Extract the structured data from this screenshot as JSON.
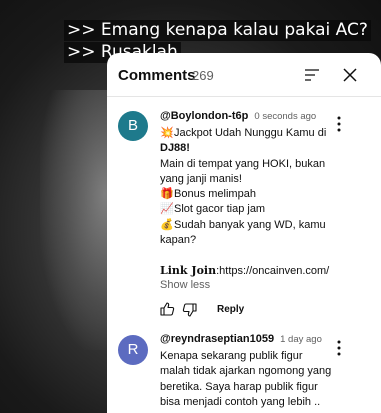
{
  "video": {
    "captions": [
      ">> Emang kenapa kalau pakai AC?",
      ">> Rusaklah"
    ]
  },
  "comments_panel": {
    "title": "Comments",
    "count": "269",
    "comments": [
      {
        "avatar_letter": "B",
        "avatar_color": "#1e7a8c",
        "author": "@Boylondon-t6p",
        "time": "0 seconds ago",
        "lines": [
          {
            "emoji": "💥",
            "text": "Jackpot Udah Nunggu Kamu di"
          },
          {
            "emoji": "",
            "text": "DJ88!"
          },
          {
            "emoji": "",
            "text": "Main di tempat yang HOKI, bukan"
          },
          {
            "emoji": "",
            "text": "yang janji manis!"
          },
          {
            "emoji": "🎁",
            "text": "Bonus melimpah"
          },
          {
            "emoji": "📈",
            "text": "Slot gacor tiap jam"
          },
          {
            "emoji": "💰",
            "text": "Sudah banyak yang WD, kamu"
          },
          {
            "emoji": "",
            "text": "kapan?"
          }
        ],
        "link_label": "Link Join",
        "link_url": ":https://oncainven.com/",
        "show_less": "Show less",
        "reply": "Reply"
      },
      {
        "avatar_letter": "R",
        "avatar_color": "#5c6bc0",
        "author": "@reyndraseptian1059",
        "time": "1 day ago",
        "lines": [
          "Kenapa sekarang publik figur",
          "malah tidak ajarkan ngomong yang",
          "beretika. Saya harap publik figur",
          "bisa menjadi contoh yang lebih .."
        ]
      }
    ]
  },
  "icons": {
    "sort": "sort-icon",
    "close": "close-icon",
    "more": "more-vert-icon",
    "like": "thumbs-up-icon",
    "dislike": "thumbs-down-icon"
  }
}
